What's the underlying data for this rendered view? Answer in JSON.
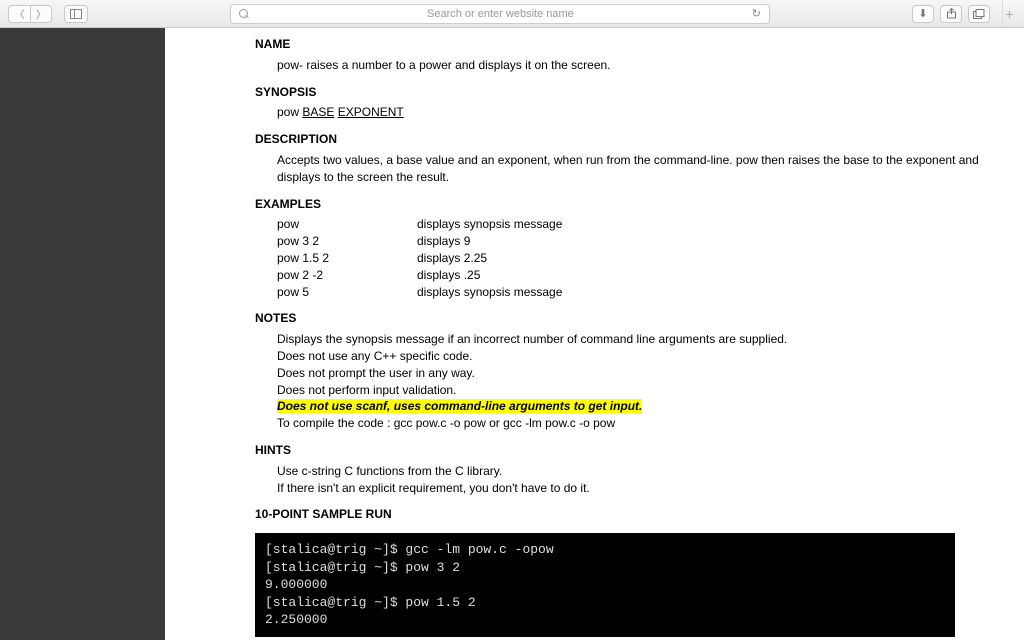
{
  "toolbar": {
    "address_placeholder": "Search or enter website name"
  },
  "doc": {
    "name_h": "NAME",
    "name_text": "pow- raises a number to a power and displays it on the screen.",
    "synopsis_h": "SYNOPSIS",
    "syn_cmd": "pow ",
    "syn_base": "BASE",
    "syn_sep": "   ",
    "syn_exp": "EXPONENT",
    "description_h": "DESCRIPTION",
    "description_text": "Accepts two values, a base value and an exponent, when run from the command-line.  pow then raises the base to the exponent and displays to the screen the result.",
    "examples_h": "EXAMPLES",
    "examples": [
      {
        "cmd": "pow",
        "out": "displays synopsis message"
      },
      {
        "cmd": "pow 3   2",
        "out": "displays 9"
      },
      {
        "cmd": "pow 1.5   2",
        "out": "displays 2.25"
      },
      {
        "cmd": "pow 2    -2",
        "out": "displays   .25"
      },
      {
        "cmd": "pow 5",
        "out": "displays synopsis message"
      }
    ],
    "notes_h": "NOTES",
    "notes": [
      "Displays the synopsis message if an incorrect number of command line arguments are supplied.",
      "Does not use any C++ specific code.",
      "Does not prompt the user in any way.",
      "Does not perform input validation."
    ],
    "note_highlight": "Does not use scanf, uses command-line arguments to get input.",
    "note_compile": "To compile the code :    gcc pow.c -o pow or gcc -lm pow.c -o pow",
    "hints_h": "HINTS",
    "hints": [
      "Use c-string C functions from the C library.",
      "If there isn't an explicit requirement, you don't have to do it."
    ],
    "sample_h": "10-POINT SAMPLE RUN",
    "terminal_lines": [
      "[stalica@trig ~]$ gcc -lm pow.c -opow",
      "[stalica@trig ~]$ pow 3 2",
      "9.000000",
      "[stalica@trig ~]$ pow 1.5 2",
      "2.250000"
    ]
  }
}
